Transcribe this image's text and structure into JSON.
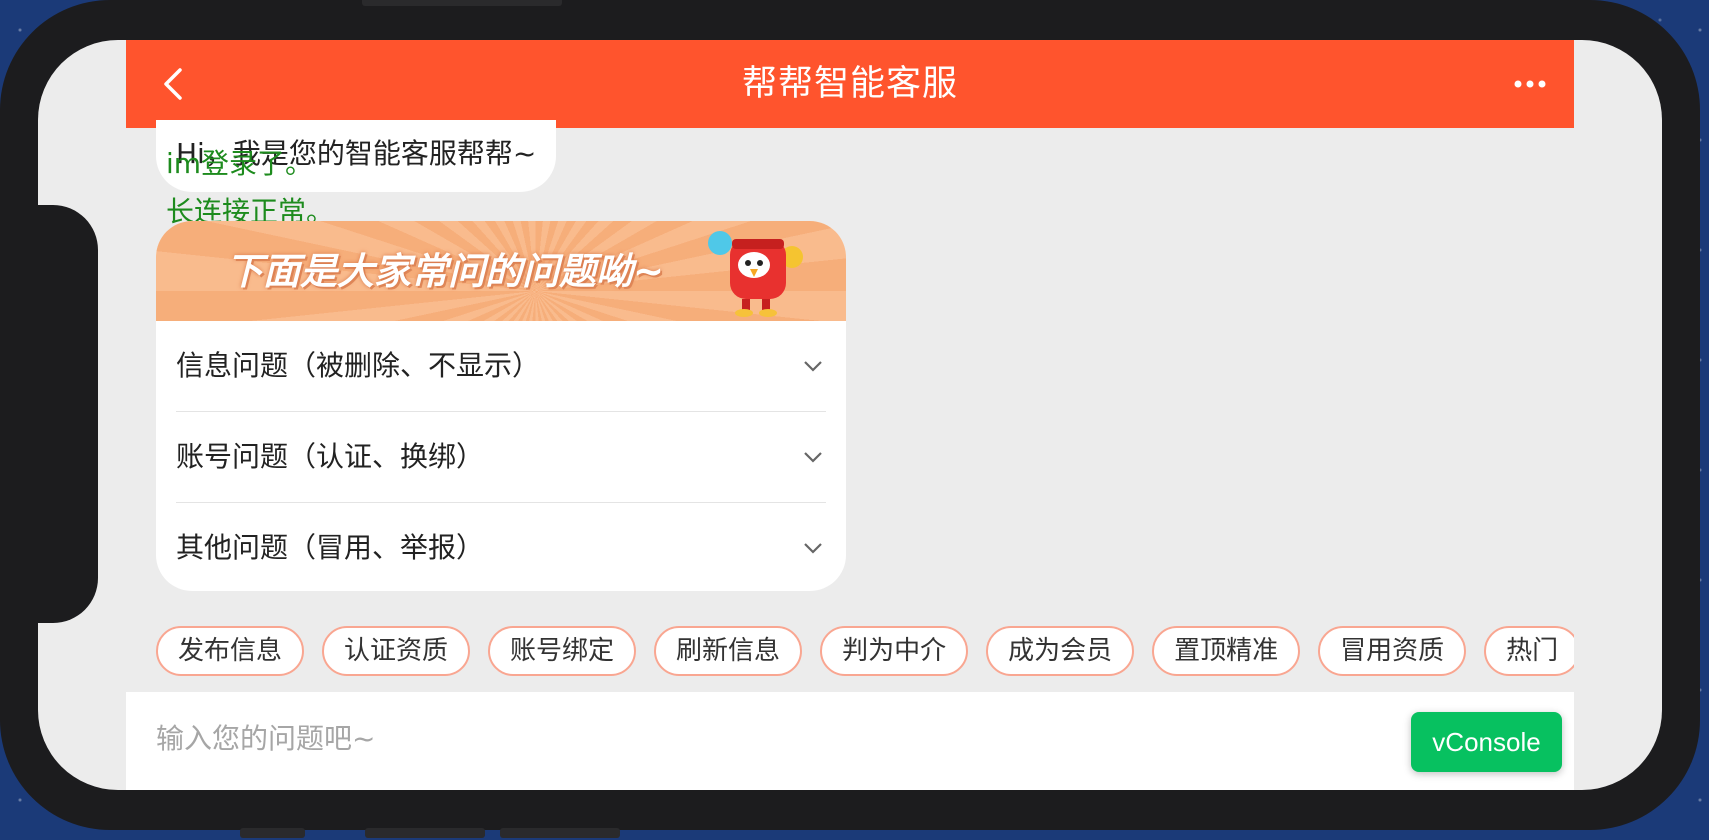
{
  "header": {
    "title": "帮帮智能客服",
    "back_icon": "chevron-left-icon",
    "more_icon": "more-dots-icon"
  },
  "chat": {
    "greeting": "Hi，我是您的智能客服帮帮~",
    "logs": [
      "im登录了。",
      "长连接正常。"
    ]
  },
  "faq": {
    "banner_text": "下面是大家常问的问题呦~",
    "items": [
      {
        "label": "信息问题（被删除、不显示）"
      },
      {
        "label": "账号问题（认证、换绑）"
      },
      {
        "label": "其他问题（冒用、举报）"
      }
    ]
  },
  "quick_tags": [
    "发布信息",
    "认证资质",
    "账号绑定",
    "刷新信息",
    "判为中介",
    "成为会员",
    "置顶精准",
    "冒用资质",
    "热门"
  ],
  "input": {
    "placeholder": "输入您的问题吧~"
  },
  "vconsole_label": "vConsole",
  "colors": {
    "header": "#ff542d",
    "log_text": "#1d8b1d",
    "chip_border": "#f9a691",
    "vconsole": "#07c160"
  }
}
